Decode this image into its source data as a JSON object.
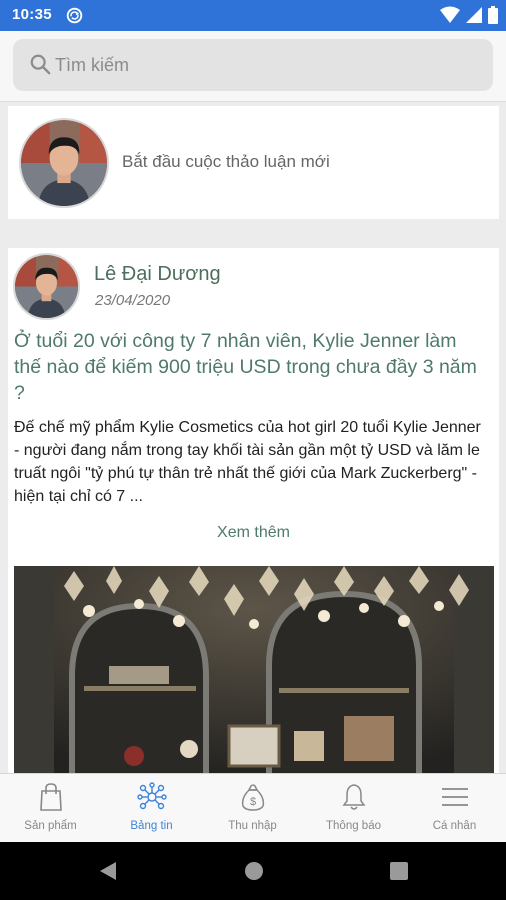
{
  "status_bar": {
    "time": "10:35"
  },
  "search": {
    "placeholder": "Tìm kiếm"
  },
  "composer": {
    "prompt": "Bắt đầu cuộc thảo luận mới"
  },
  "post": {
    "author": "Lê Đại Dương",
    "date": "23/04/2020",
    "title": "Ở tuổi 20 với công ty 7 nhân viên, Kylie Jenner làm thế nào để kiếm 900 triệu USD trong chưa đầy 3 năm ?",
    "excerpt": "Đế chế mỹ phẩm Kylie Cosmetics của hot girl 20 tuổi Kylie Jenner - người đang nắm trong tay khối tài sản gần một tỷ USD và lăm le truất ngôi \"tỷ phú tự thân trẻ nhất thế giới của Mark Zuckerberg\" - hiện tại chỉ có 7 ...",
    "see_more": "Xem thêm"
  },
  "bottom_nav": {
    "items": [
      {
        "label": "Sản phẩm",
        "icon": "shopping-bag-icon"
      },
      {
        "label": "Bảng tin",
        "icon": "network-icon"
      },
      {
        "label": "Thu nhập",
        "icon": "money-bag-icon"
      },
      {
        "label": "Thông báo",
        "icon": "bell-icon"
      },
      {
        "label": "Cá nhân",
        "icon": "menu-icon"
      }
    ],
    "active_index": 1
  },
  "colors": {
    "status_bar": "#2f73d8",
    "accent_green": "#4f7a6a",
    "active_tab": "#3c84d8"
  }
}
